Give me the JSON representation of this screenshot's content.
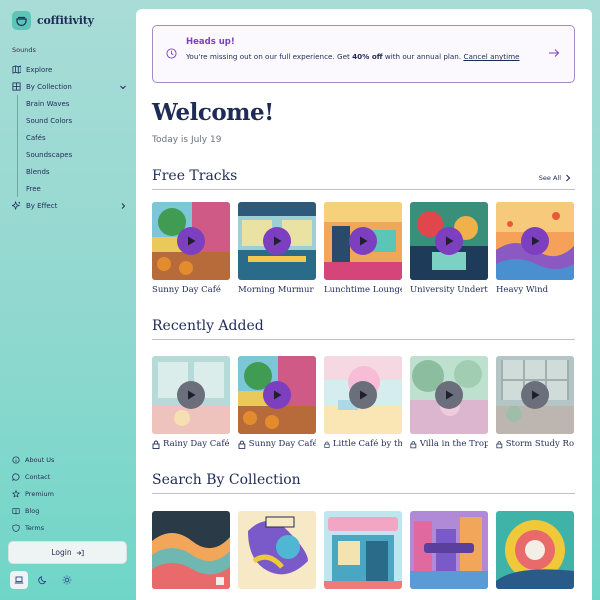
{
  "brand": {
    "name": "coffitivity"
  },
  "sidebar": {
    "section_label": "Sounds",
    "items": [
      {
        "label": "Explore",
        "icon": "map-icon"
      },
      {
        "label": "By Collection",
        "icon": "grid-icon"
      }
    ],
    "collections": [
      "Brain Waves",
      "Sound Colors",
      "Cafés",
      "Soundscapes",
      "Blends",
      "Free"
    ],
    "by_effect": {
      "label": "By Effect",
      "icon": "sparkle-icon"
    },
    "footer": [
      {
        "label": "About Us",
        "icon": "info-icon"
      },
      {
        "label": "Contact",
        "icon": "chat-icon"
      },
      {
        "label": "Premium",
        "icon": "star-icon"
      },
      {
        "label": "Blog",
        "icon": "book-icon"
      },
      {
        "label": "Terms",
        "icon": "shield-icon"
      }
    ],
    "login_label": "Login"
  },
  "banner": {
    "title": "Heads up!",
    "text_before": "You're missing out on our full experience. Get ",
    "highlight": "40% off",
    "text_after": " with our annual plan. ",
    "link": "Cancel anytime",
    "accent": "#7b3fbf"
  },
  "welcome": {
    "title": "Welcome!",
    "date": "Today is July 19"
  },
  "free_tracks": {
    "title": "Free Tracks",
    "see_all": "See All",
    "items": [
      "Sunny Day Café",
      "Morning Murmur",
      "Lunchtime Lounge",
      "University Undertones",
      "Heavy Wind"
    ]
  },
  "recently_added": {
    "title": "Recently Added",
    "items": [
      "Rainy Day Café",
      "Sunny Day Café",
      "Little Café by the Sea",
      "Villa in the Tropics",
      "Storm Study Room"
    ]
  },
  "search_collection": {
    "title": "Search By Collection"
  }
}
